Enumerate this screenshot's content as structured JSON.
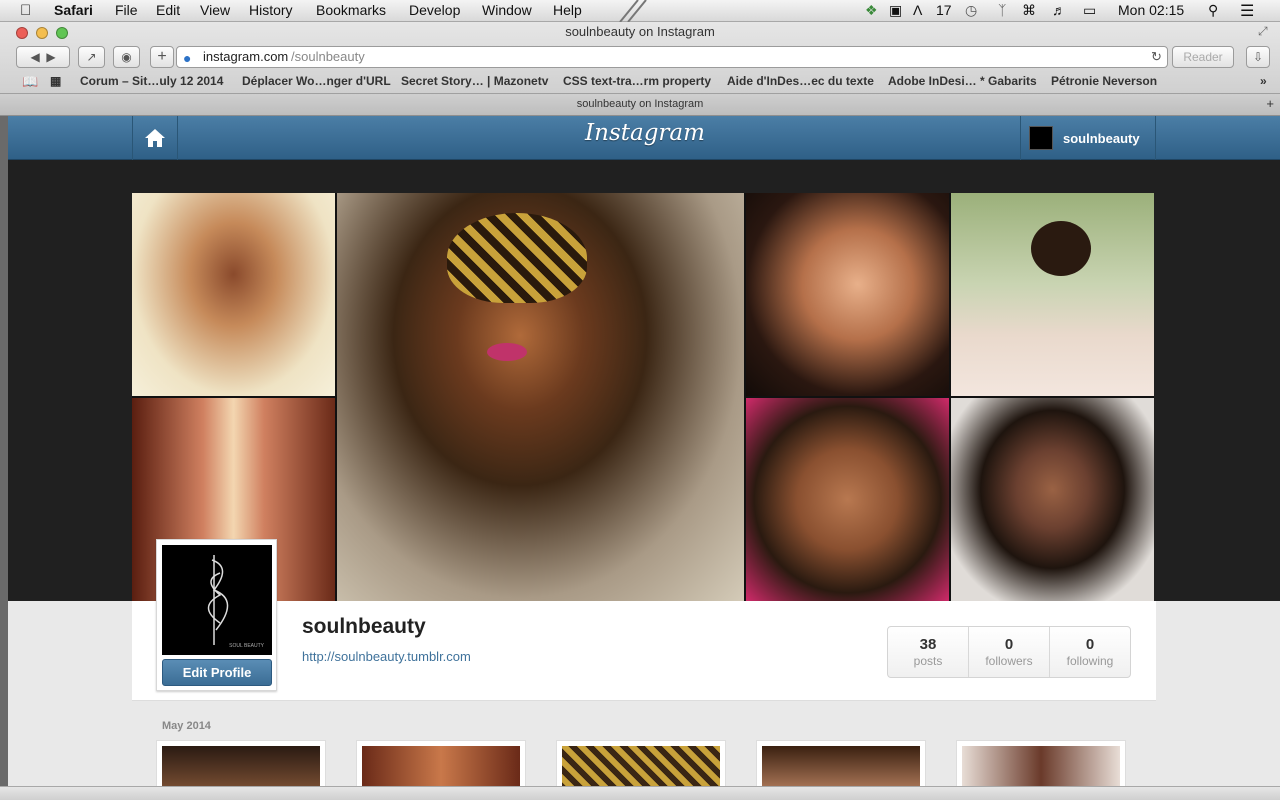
{
  "menubar": {
    "apple_icon": "apple-icon",
    "app": "Safari",
    "items": [
      "File",
      "Edit",
      "View",
      "History",
      "Bookmarks",
      "Develop",
      "Window",
      "Help"
    ],
    "tray_count": "17",
    "clock": "Mon 02:15"
  },
  "browser": {
    "window_title": "soulnbeauty on Instagram",
    "url_domain": "instagram.com",
    "url_path": "/soulnbeauty",
    "reader_label": "Reader",
    "tab_title": "soulnbeauty on Instagram",
    "bookmarks": [
      "Corum – Sit…uly 12 2014",
      "Déplacer Wo…nger d'URL",
      "Secret Story… | Mazonetv",
      "CSS text-tra…rm property",
      "Aide d'InDes…ec du texte",
      "Adobe InDesi… * Gabarits",
      "Pétronie Neverson"
    ]
  },
  "instagram": {
    "logo": "Instagram",
    "header_username": "soulnbeauty",
    "profile": {
      "username": "soulnbeauty",
      "website": "http://soulnbeauty.tumblr.com",
      "edit_profile_label": "Edit Profile",
      "avatar_caption": "SOUL BEAUTY",
      "stats": [
        {
          "value": "38",
          "label": "posts"
        },
        {
          "value": "0",
          "label": "followers"
        },
        {
          "value": "0",
          "label": "following"
        }
      ]
    },
    "feed": {
      "month_label": "May 2014"
    }
  },
  "colors": {
    "header_blue": "#3f729b",
    "link_blue": "#3f729b",
    "button_blue": "#4a7ea6"
  }
}
